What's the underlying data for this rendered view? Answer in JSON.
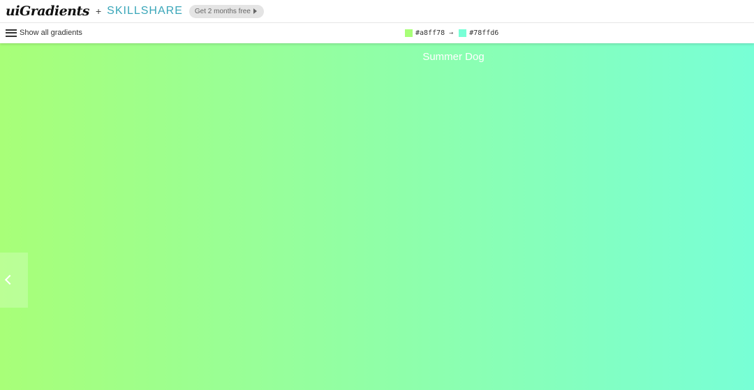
{
  "header": {
    "logo": "uiGradients",
    "plus": "+",
    "partner": "SKILLSHARE",
    "promo_label": "Get 2 months free"
  },
  "toolbar": {
    "menu_label": "Show all gradients",
    "color_from": "#a8ff78",
    "arrow": "→",
    "color_to": "#78ffd6"
  },
  "gradient": {
    "name": "Summer Dog",
    "colors": [
      "#a8ff78",
      "#78ffd6"
    ]
  },
  "icons": {
    "menu": "hamburger-icon",
    "promo": "play-arrow-icon",
    "previous": "chevron-left-icon"
  }
}
